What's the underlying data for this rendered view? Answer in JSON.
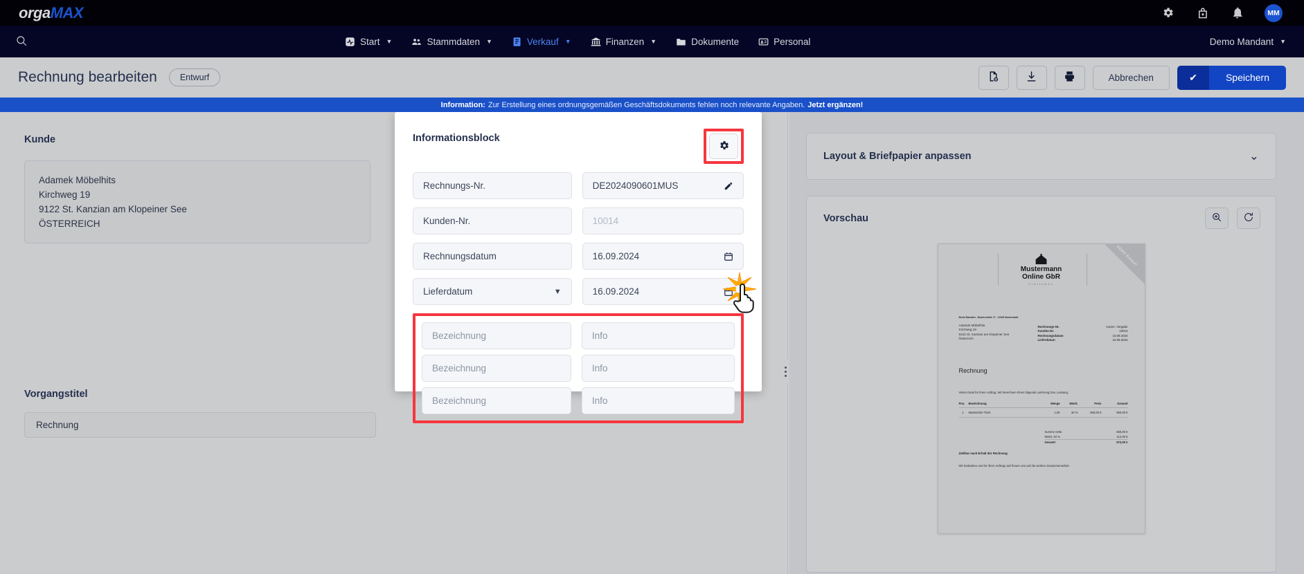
{
  "topbar": {
    "logo_orga": "orga",
    "logo_max": "MAX",
    "icons": [
      "gear-icon",
      "shop-lock-icon",
      "bell-icon"
    ],
    "avatar_initials": "MM"
  },
  "nav": {
    "search_icon": "search-icon",
    "items": [
      {
        "label": "Start",
        "icon": "activity-icon",
        "has_caret": true,
        "active": false
      },
      {
        "label": "Stammdaten",
        "icon": "users-icon",
        "has_caret": true,
        "active": false
      },
      {
        "label": "Verkauf",
        "icon": "invoice-icon",
        "has_caret": true,
        "active": true
      },
      {
        "label": "Finanzen",
        "icon": "bank-icon",
        "has_caret": true,
        "active": false
      },
      {
        "label": "Dokumente",
        "icon": "folder-icon",
        "has_caret": false,
        "active": false
      },
      {
        "label": "Personal",
        "icon": "id-card-icon",
        "has_caret": false,
        "active": false
      }
    ],
    "mandant": "Demo Mandant"
  },
  "header": {
    "title": "Rechnung bearbeiten",
    "status_badge": "Entwurf",
    "icon_buttons": [
      "document-preview-icon",
      "download-icon",
      "print-icon"
    ],
    "cancel_label": "Abbrechen",
    "save_label": "Speichern"
  },
  "banner": {
    "prefix": "Information:",
    "text": "Zur Erstellung eines ordnungsgemäßen Geschäftsdokuments fehlen noch relevante Angaben.",
    "link": "Jetzt ergänzen!",
    "color": "#1a51c9"
  },
  "customer": {
    "section_title": "Kunde",
    "address": [
      "Adamek Möbelhits",
      "Kirchweg 19",
      "9122 St. Kanzian am Klopeiner See",
      "ÖSTERREICH"
    ]
  },
  "vorgang": {
    "section_title": "Vorgangstitel",
    "value": "Rechnung"
  },
  "modal": {
    "title": "Informationsblock",
    "gear_icon": "gear-icon",
    "highlight_color": "#f6363f",
    "rows": [
      {
        "label": "Rechnungs-Nr.",
        "value": "DE2024090601MUS",
        "value_muted": false,
        "end_icon": "pencil-icon",
        "type": "text"
      },
      {
        "label": "Kunden-Nr.",
        "value": "10014",
        "value_muted": true,
        "end_icon": "",
        "type": "text"
      },
      {
        "label": "Rechnungsdatum",
        "value": "16.09.2024",
        "value_muted": false,
        "end_icon": "calendar-icon",
        "type": "date"
      },
      {
        "label": "Lieferdatum",
        "value": "16.09.2024",
        "value_muted": false,
        "end_icon": "calendar-icon",
        "type": "date",
        "label_is_select": true
      }
    ],
    "info_rows": [
      {
        "label_placeholder": "Bezeichnung",
        "value_placeholder": "Info"
      },
      {
        "label_placeholder": "Bezeichnung",
        "value_placeholder": "Info"
      },
      {
        "label_placeholder": "Bezeichnung",
        "value_placeholder": "Info"
      }
    ]
  },
  "sidebar": {
    "layout_panel_title": "Layout & Briefpapier anpassen",
    "layout_chevron": "chevron-down-icon",
    "preview_title": "Vorschau",
    "preview_buttons": [
      "zoom-in-icon",
      "refresh-icon"
    ]
  },
  "preview_document": {
    "ribbon": "DEMO Entwurf",
    "company_name_line1": "Mustermann",
    "company_name_line2": "Online GbR",
    "company_tagline": "Craftsmen",
    "sender_line": "Beste Mandant - Musterstraße 17 - 12345 Musterstadt",
    "recipient": [
      "Adamek Möbelhits",
      "Kirchweg 19",
      "9122 St. Kanzian am Klopeiner See",
      "Österreich"
    ],
    "meta": [
      {
        "label": "Rechnungs-Nr.",
        "value": "Autom. Vergabe"
      },
      {
        "label": "Kunden-Nr.",
        "value": "10014"
      },
      {
        "label": "Rechnungsdatum",
        "value": "16.09.2024"
      },
      {
        "label": "Lieferdatum",
        "value": "16.09.2024"
      }
    ],
    "doc_heading": "Rechnung",
    "intro": "Vielen Dank für Ihren Auftrag. Wir berechnen Ihnen folgende Lieferung bzw. Leistung:",
    "table_headers": [
      "Pos.",
      "Bezeichnung",
      "Menge",
      "MwSt.",
      "Preis",
      "Gesamt"
    ],
    "table_rows": [
      {
        "pos": "1.",
        "desc": "Massivholz-Tisch",
        "menge": "1,00",
        "mwst": "20 %",
        "preis": "560,00 €",
        "gesamt": "560,00 €"
      }
    ],
    "sums": [
      {
        "label": "Summe netto",
        "value": "560,00 €",
        "total": false
      },
      {
        "label": "MwSt. 20 %",
        "value": "112,00 €",
        "total": false
      },
      {
        "label": "Gesamt",
        "value": "672,00 €",
        "total": true
      }
    ],
    "payment_line": "Zahlbar nach Erhalt der Rechnung",
    "closing": "Wir bedanken uns für Ihren Auftrag und freuen uns auf die weitere Zusammenarbeit."
  }
}
